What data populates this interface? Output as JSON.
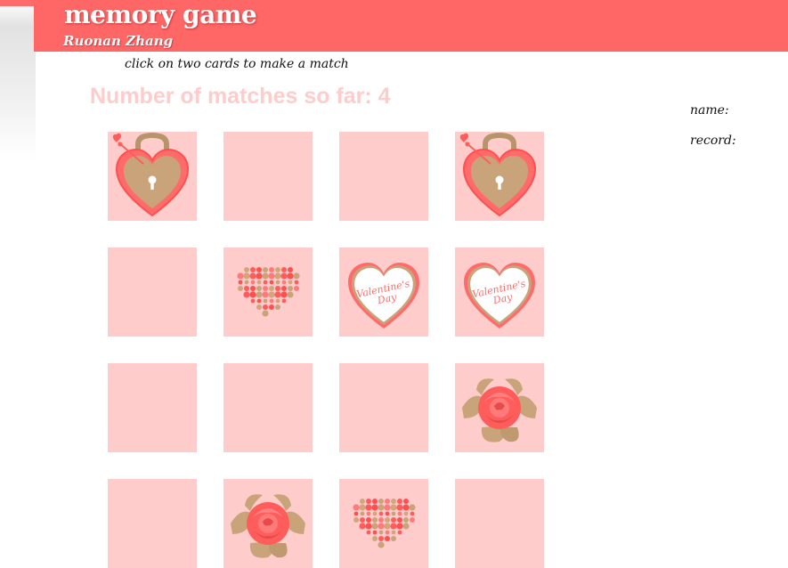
{
  "header": {
    "title": "memory game",
    "author": "Ruonan Zhang"
  },
  "instruction": "click on two cards to make a match",
  "status": {
    "matches_text": "Number of matches so far: 4"
  },
  "sidebar": {
    "name_label": "name:",
    "record_label": "record:"
  },
  "colors": {
    "header_bg": "#ff6666",
    "card_back": "#ffcccc",
    "accent_red": "#ff5c5c",
    "gold": "#c9a47a"
  },
  "cards": [
    {
      "face": "lock-heart-icon",
      "state": "revealed"
    },
    {
      "face": "",
      "state": "hidden"
    },
    {
      "face": "",
      "state": "hidden"
    },
    {
      "face": "lock-heart-icon",
      "state": "revealed"
    },
    {
      "face": "",
      "state": "hidden"
    },
    {
      "face": "dotted-heart-icon",
      "state": "revealed"
    },
    {
      "face": "valentines-day-heart-icon",
      "state": "revealed"
    },
    {
      "face": "valentines-day-heart-icon",
      "state": "revealed"
    },
    {
      "face": "",
      "state": "hidden"
    },
    {
      "face": "",
      "state": "hidden"
    },
    {
      "face": "",
      "state": "hidden"
    },
    {
      "face": "rose-icon",
      "state": "revealed"
    },
    {
      "face": "",
      "state": "hidden"
    },
    {
      "face": "rose-icon",
      "state": "revealed"
    },
    {
      "face": "dotted-heart-icon",
      "state": "revealed"
    },
    {
      "face": "",
      "state": "hidden"
    }
  ],
  "valentine_text": [
    "Valentine's",
    "Day"
  ]
}
